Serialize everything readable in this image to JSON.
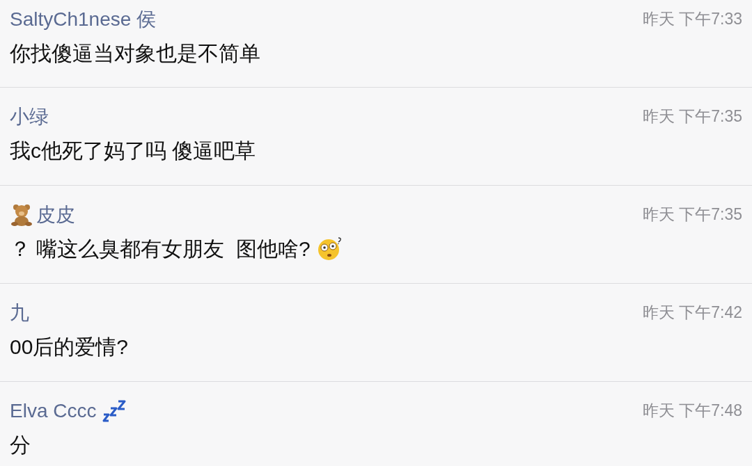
{
  "messages": [
    {
      "kind": "plain",
      "name": "SaltyCh1nese 侯",
      "time": "昨天 下午7:33",
      "text": "你找傻逼当对象也是不简单",
      "reaction": false
    },
    {
      "kind": "plain",
      "name": "小绿",
      "time": "昨天 下午7:35",
      "text": "我c他死了妈了吗 傻逼吧草",
      "reaction": false
    },
    {
      "kind": "icon-before",
      "name": "皮皮",
      "time": "昨天 下午7:35",
      "text": "？ 嘴这么臭都有女朋友  图他啥?",
      "reaction": true
    },
    {
      "kind": "plain",
      "name": "九",
      "time": "昨天 下午7:42",
      "text": "00后的爱情?",
      "reaction": false
    },
    {
      "kind": "icon-after",
      "name": "Elva Cccc",
      "time": "昨天 下午7:48",
      "text": "分",
      "reaction": false
    }
  ]
}
